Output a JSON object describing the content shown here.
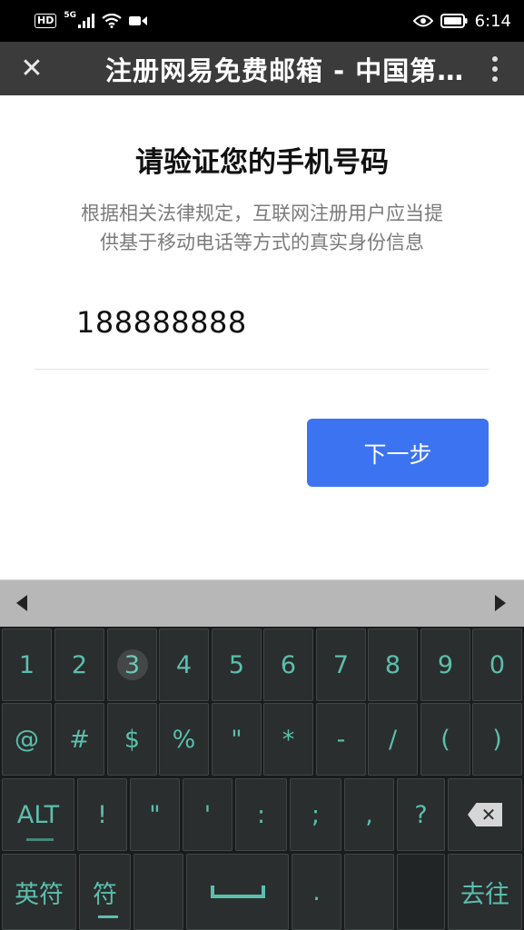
{
  "status_bar": {
    "hd": "HD",
    "network": "5G",
    "signal_icon": "signal-bars-icon",
    "wifi_icon": "wifi-icon",
    "video_icon": "video-camera-icon",
    "eye_icon": "eye-icon",
    "battery_icon": "battery-icon",
    "time": "6:14"
  },
  "title_bar": {
    "close_glyph": "✕",
    "title": "注册网易免费邮箱 - 中国第一大电子邮件服务商",
    "menu_icon": "more-vertical-icon"
  },
  "page": {
    "heading": "请验证您的手机号码",
    "description_line1": "根据相关法律规定，互联网注册用户应当提",
    "description_line2": "供基于移动电话等方式的真实身份信息",
    "phone_value": "188888888",
    "next_button": "下一步"
  },
  "candidate_bar": {
    "left_icon": "arrow-left-icon",
    "right_icon": "arrow-right-icon"
  },
  "keyboard": {
    "row1": [
      "1",
      "2",
      "3",
      "4",
      "5",
      "6",
      "7",
      "8",
      "9",
      "0"
    ],
    "row2": [
      "@",
      "#",
      "$",
      "%",
      "\"",
      "*",
      "-",
      "/",
      "(",
      ")"
    ],
    "row3": [
      "ALT",
      "!",
      "\"",
      "'",
      ":",
      ";",
      ",",
      "?"
    ],
    "row3_backspace_icon": "backspace-icon",
    "row4": {
      "lang": "英符",
      "sym": "符",
      "space_icon": "space-bar-icon",
      "period": ".",
      "go": "去往"
    },
    "colors": {
      "key_bg": "#2b2e2e",
      "key_text": "#5bbfae",
      "keyboard_bg": "#1a1c1c"
    }
  }
}
